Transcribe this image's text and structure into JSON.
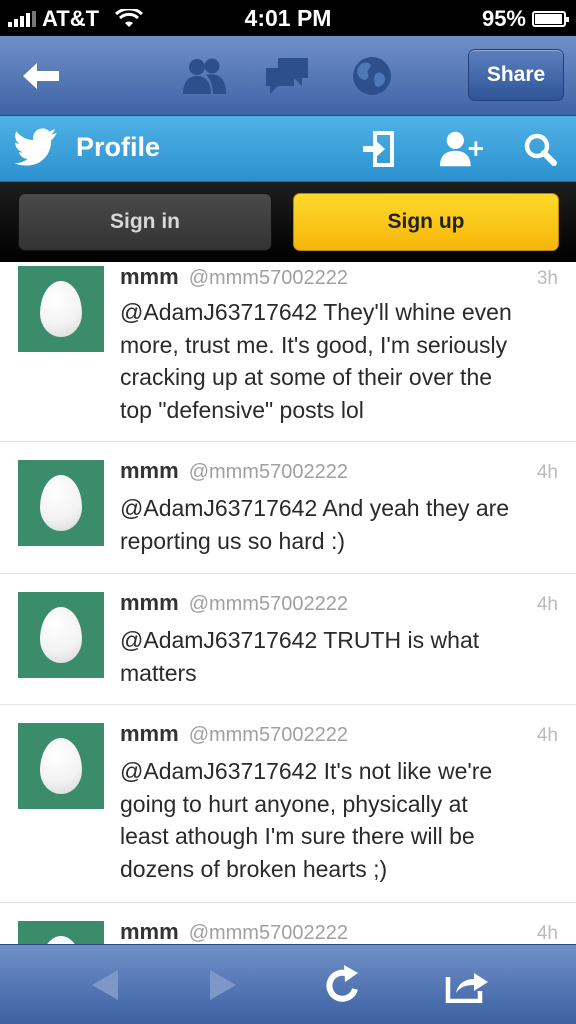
{
  "status": {
    "carrier": "AT&T",
    "time": "4:01 PM",
    "battery": "95%",
    "battery_level": 0.95
  },
  "topnav": {
    "share_label": "Share",
    "icons": [
      "back-arrow-icon",
      "people-icon",
      "chat-bubbles-icon",
      "globe-icon"
    ]
  },
  "twitter_bar": {
    "title": "Profile",
    "icons": [
      "twitter-bird-icon",
      "sign-in-icon",
      "add-user-icon",
      "search-icon"
    ]
  },
  "auth": {
    "signin_label": "Sign in",
    "signup_label": "Sign up"
  },
  "tweets": [
    {
      "name": "mmm",
      "handle": "@mmm57002222",
      "time": "3h",
      "lines": [
        "@AdamJ63717642 They'll whine even",
        "more, trust me. It's good, I'm seriously",
        "cracking up at some of their over the",
        "top \"defensive\" posts lol"
      ]
    },
    {
      "name": "mmm",
      "handle": "@mmm57002222",
      "time": "4h",
      "lines": [
        "@AdamJ63717642 And yeah they are",
        "reporting us so hard :)"
      ]
    },
    {
      "name": "mmm",
      "handle": "@mmm57002222",
      "time": "4h",
      "lines": [
        "@AdamJ63717642 TRUTH is what",
        "matters"
      ]
    },
    {
      "name": "mmm",
      "handle": "@mmm57002222",
      "time": "4h",
      "lines": [
        "@AdamJ63717642 It's not like we're",
        "going to hurt anyone, physically at",
        "least athough I'm sure there will be",
        "dozens of broken hearts ;)"
      ]
    },
    {
      "name": "mmm",
      "handle": "@mmm57002222",
      "time": "4h",
      "lines": []
    }
  ],
  "toolbar": {
    "icons": [
      "back-icon",
      "forward-icon",
      "reload-icon",
      "share-icon"
    ]
  },
  "colors": {
    "nav_blue": "#4a6db0",
    "twitter_blue": "#35a0dc",
    "signup_yellow": "#fcc81a",
    "avatar_green": "#3a8c6b"
  }
}
